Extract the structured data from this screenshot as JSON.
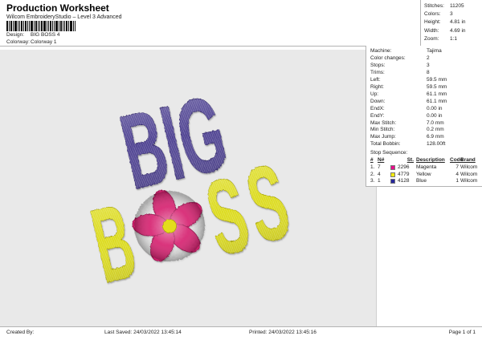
{
  "header": {
    "title": "Production Worksheet",
    "subtitle": "Wilcom EmbroideryStudio – Level 3 Advanced",
    "design_label": "Design:",
    "design_value": "BIG BOSS 4",
    "colorway_label": "Colorway:",
    "colorway_value": "Colorway 1"
  },
  "summary": {
    "rows": [
      {
        "label": "Stitches:",
        "value": "11205"
      },
      {
        "label": "Colors:",
        "value": "3"
      },
      {
        "label": "Height:",
        "value": "4.81 in"
      },
      {
        "label": "Width:",
        "value": "4.69 in"
      },
      {
        "label": "Zoom:",
        "value": "1:1"
      }
    ]
  },
  "machine_panel": {
    "rows": [
      {
        "label": "Machine:",
        "value": "Tajima"
      },
      {
        "label": "Color changes:",
        "value": "2"
      },
      {
        "label": "Stops:",
        "value": "3"
      },
      {
        "label": "Trims:",
        "value": "8"
      },
      {
        "label": "Left:",
        "value": "59.5 mm"
      },
      {
        "label": "Right:",
        "value": "59.5 mm"
      },
      {
        "label": "Up:",
        "value": "61.1 mm"
      },
      {
        "label": "Down:",
        "value": "61.1 mm"
      },
      {
        "label": "EndX:",
        "value": "0.00 in"
      },
      {
        "label": "EndY:",
        "value": "0.00 in"
      },
      {
        "label": "Max Stitch:",
        "value": "7.0 mm"
      },
      {
        "label": "Min Stitch:",
        "value": "0.2 mm"
      },
      {
        "label": "Max Jump:",
        "value": "6.9 mm"
      },
      {
        "label": "Total Bobbin:",
        "value": "128.00ft"
      }
    ],
    "stop_sequence": {
      "title": "Stop Sequence:",
      "columns": [
        "#",
        "N#",
        "St.",
        "Description",
        "Code",
        "Brand"
      ],
      "rows": [
        {
          "num": "1.",
          "n": "7",
          "swatch": "#e80d8d",
          "st": "2296",
          "description": "Magenta",
          "code": "7",
          "brand": "Wilcom"
        },
        {
          "num": "2.",
          "n": "4",
          "swatch": "#f2ea0e",
          "st": "4779",
          "description": "Yellow",
          "code": "4",
          "brand": "Wilcom"
        },
        {
          "num": "3.",
          "n": "1",
          "swatch": "#26279b",
          "st": "4128",
          "description": "Blue",
          "code": "1",
          "brand": "Wilcom"
        }
      ]
    }
  },
  "design_preview": {
    "line1": "BIG",
    "line2_letters": [
      "B",
      "S",
      "S"
    ],
    "colors": {
      "purple": "#4f4392",
      "yellow": "#dcdb1e",
      "magenta": "#d62371",
      "flower_center": "#e3de1c"
    }
  },
  "footer": {
    "created_by": "Created By:",
    "last_saved": "Last Saved: 24/03/2022 13:45:14",
    "printed": "Printed: 24/03/2022 13:45:16",
    "page": "Page 1 of 1"
  }
}
